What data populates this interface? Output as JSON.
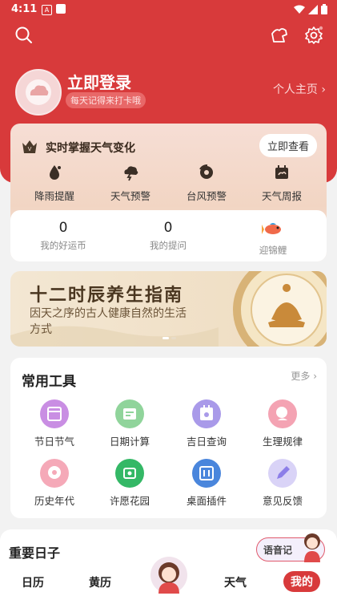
{
  "status_bar": {
    "time": "4:11",
    "notif_glyph": "A"
  },
  "header": {
    "login_title": "立即登录",
    "login_subtitle": "每天记得来打卡哦",
    "profile_link": "个人主页",
    "chevron": "›"
  },
  "weather_card": {
    "title": "实时掌握天气变化",
    "button": "立即查看",
    "items": [
      {
        "label": "降雨提醒",
        "icon": "rain-drop-icon"
      },
      {
        "label": "天气预警",
        "icon": "storm-cloud-icon"
      },
      {
        "label": "台风预警",
        "icon": "typhoon-icon"
      },
      {
        "label": "天气周报",
        "icon": "weekly-report-icon"
      }
    ]
  },
  "stats": [
    {
      "value": "0",
      "label": "我的好运币"
    },
    {
      "value": "0",
      "label": "我的提问"
    },
    {
      "value": "",
      "label": "迎锦鲤"
    }
  ],
  "banner": {
    "title": "十二时辰养生指南",
    "subtitle": "因天之序的古人健康自然的生活方式"
  },
  "tools": {
    "title": "常用工具",
    "more": "更多",
    "items": [
      {
        "label": "节日节气",
        "color": "#b562d6"
      },
      {
        "label": "日期计算",
        "color": "#6cc47a"
      },
      {
        "label": "吉日查询",
        "color": "#8a7be0"
      },
      {
        "label": "生理规律",
        "color": "#f07c93"
      },
      {
        "label": "历史年代",
        "color": "#f08aa0"
      },
      {
        "label": "许愿花园",
        "color": "#2fb360"
      },
      {
        "label": "桌面插件",
        "color": "#3e7fd8"
      },
      {
        "label": "意见反馈",
        "color": "#8c7ee8"
      }
    ]
  },
  "bottom": {
    "section_title": "重要日子",
    "voice_button": "语音记",
    "nav": [
      "日历",
      "黄历",
      "天气",
      "我的"
    ]
  },
  "colors": {
    "brand_red": "#d83a3b"
  }
}
